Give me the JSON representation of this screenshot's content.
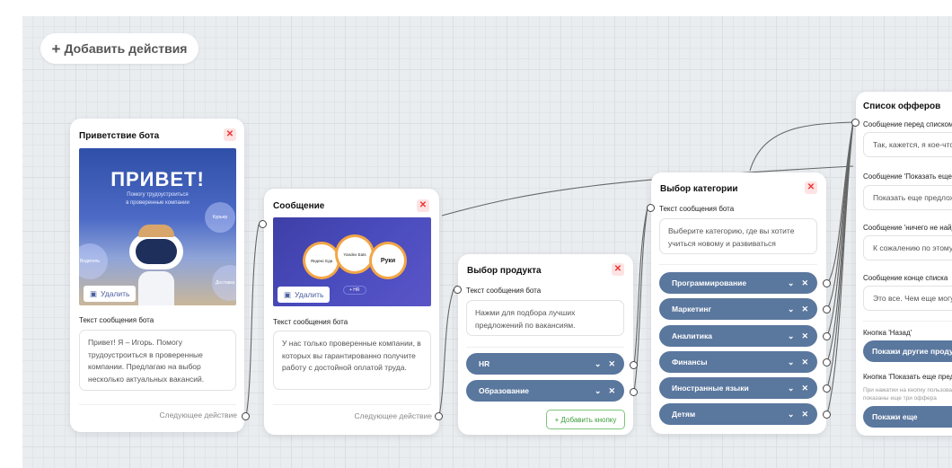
{
  "toolbar": {
    "add_actions_icon": "plus-icon",
    "add_actions_label": "Добавить действия"
  },
  "nodes": {
    "greeting": {
      "title": "Приветствие бота",
      "image": {
        "headline": "ПРИВЕТ!",
        "subline1": "Помогу трудоустроиться",
        "subline2": "в проверенные компании",
        "bubble_courier": "Курьер",
        "bubble_driver": "Водитель",
        "bubble_delivery": "Доставка еды"
      },
      "delete_label": "Удалить",
      "text_label": "Текст сообщения бота",
      "text": "Привет! Я – Игорь. Помогу трудоустроиться в проверенные компании. Предлагаю на выбор несколько актуальных вакансий.",
      "next_label": "Следующее действие"
    },
    "message": {
      "title": "Сообщение",
      "image": {
        "logo1": "Яндекс Еда",
        "logo2": "Yandex Eats",
        "logo3": "Руки",
        "badge": "+ HR"
      },
      "delete_label": "Удалить",
      "text_label": "Текст сообщения бота",
      "text": "У нас только проверенные компании, в которых вы гарантированно получите работу с достойной оплатой труда.",
      "next_label": "Следующее действие"
    },
    "product": {
      "title": "Выбор продукта",
      "text_label": "Текст сообщения бота",
      "text": "Нажми для подбора лучших предложений по вакансиям.",
      "buttons": [
        "HR",
        "Образование"
      ],
      "add_button_label": "+ Добавить кнопку"
    },
    "category": {
      "title": "Выбор категории",
      "text_label": "Текст сообщения бота",
      "text": "Выберите категорию, где вы хотите учиться новому и развиваться",
      "buttons": [
        "Программирование",
        "Маркетинг",
        "Аналитика",
        "Финансы",
        "Иностранные языки",
        "Детям"
      ]
    },
    "offers": {
      "title": "Список офферов",
      "fields": [
        {
          "label": "Сообщение перед списком",
          "value": "Так, кажется, я кое-что нашёл"
        },
        {
          "label": "Сообщение 'Показать еще'",
          "value": "Показать еще предложения"
        },
        {
          "label": "Сообщение 'ничего не найдено'",
          "value": "К сожалению по этому запросу"
        },
        {
          "label": "Сообщение конце списка",
          "value": "Это все. Чем еще могу помочь?"
        }
      ],
      "back_button_label": "Кнопка 'Назад'",
      "back_button": "Покажи другие продукты",
      "more_button_label": "Кнопка 'Показать еще предложения'",
      "more_hint_1": "При нажатии на кнопку пользователю будут",
      "more_hint_2": "показаны еще три оффера",
      "more_button": "Покажи еще"
    }
  },
  "icons": {
    "close": "✕",
    "chevron": "⌄",
    "remove": "✕"
  },
  "colors": {
    "pill": "#5a779e",
    "close_bg": "#fde3e3",
    "close_fg": "#ee3333",
    "add_button": "#3f9d3c",
    "canvas": "#e9edf0"
  }
}
